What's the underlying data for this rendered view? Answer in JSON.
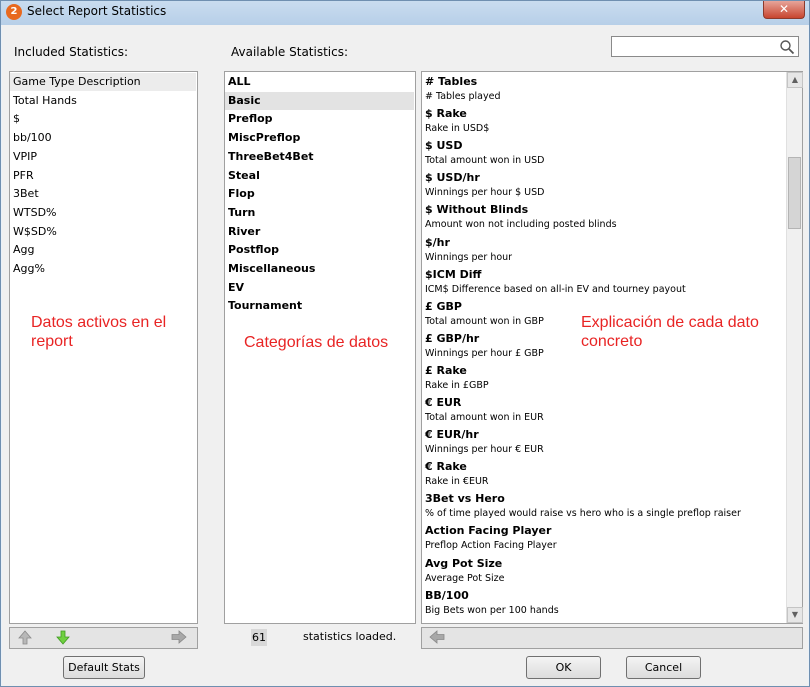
{
  "window": {
    "title": "Select Report Statistics",
    "app_icon_text": "2",
    "close_glyph": "✕"
  },
  "labels": {
    "included": "Included Statistics:",
    "available": "Available Statistics:"
  },
  "search": {
    "value": "",
    "placeholder": ""
  },
  "included_stats": [
    "Game Type Description",
    "Total Hands",
    "$",
    "bb/100",
    "VPIP",
    "PFR",
    "3Bet",
    "WTSD%",
    "W$SD%",
    "Agg",
    "Agg%"
  ],
  "categories": [
    "ALL",
    "Basic",
    "Preflop",
    "MiscPreflop",
    "ThreeBet4Bet",
    "Steal",
    "Flop",
    "Turn",
    "River",
    "Postflop",
    "Miscellaneous",
    "EV",
    "Tournament"
  ],
  "selected_category": "Basic",
  "stats": [
    {
      "name": "# Tables",
      "desc": "# Tables played"
    },
    {
      "name": "$ Rake",
      "desc": "Rake in USD$"
    },
    {
      "name": "$ USD",
      "desc": "Total amount won in USD"
    },
    {
      "name": "$ USD/hr",
      "desc": "Winnings per hour $ USD"
    },
    {
      "name": "$ Without Blinds",
      "desc": "Amount won not including posted blinds"
    },
    {
      "name": "$/hr",
      "desc": "Winnings per hour"
    },
    {
      "name": "$ICM Diff",
      "desc": "ICM$ Difference based on all-in EV and tourney payout"
    },
    {
      "name": "£ GBP",
      "desc": "Total amount won in GBP"
    },
    {
      "name": "£ GBP/hr",
      "desc": "Winnings per hour £ GBP"
    },
    {
      "name": "£ Rake",
      "desc": "Rake in £GBP"
    },
    {
      "name": "€ EUR",
      "desc": "Total amount won in EUR"
    },
    {
      "name": "€ EUR/hr",
      "desc": "Winnings per hour € EUR"
    },
    {
      "name": "€ Rake",
      "desc": "Rake in €EUR"
    },
    {
      "name": "3Bet vs Hero",
      "desc": "% of time played would raise vs hero who is a single preflop raiser"
    },
    {
      "name": "Action Facing Player",
      "desc": "Preflop Action Facing Player"
    },
    {
      "name": "Avg Pot Size",
      "desc": "Average Pot Size"
    },
    {
      "name": "BB/100",
      "desc": "Big Bets won per 100 hands"
    }
  ],
  "notes": {
    "included": "Datos activos en el report",
    "categories": "Categorías de datos",
    "stats": "Explicación de cada dato concreto"
  },
  "footer": {
    "count": "61",
    "count_label": "statistics loaded."
  },
  "buttons": {
    "default_stats": "Default Stats",
    "ok": "OK",
    "cancel": "Cancel"
  },
  "icons": {
    "up": "up-arrow-icon",
    "down": "down-arrow-icon",
    "right": "right-arrow-icon",
    "left": "left-arrow-icon",
    "search": "search-icon"
  },
  "colors": {
    "note": "#e82424",
    "down_arrow": "#6fd040"
  }
}
